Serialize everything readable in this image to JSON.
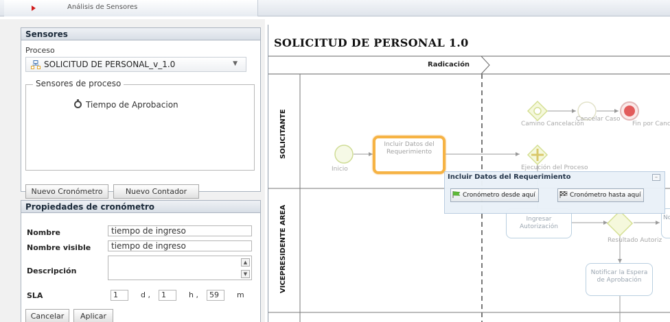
{
  "window": {
    "tab_title": "Análisis de Sensores"
  },
  "sensores_panel": {
    "header": "Sensores",
    "process_label": "Proceso",
    "process_selected": "SOLICITUD DE PERSONAL_v_1.0",
    "fieldset_legend": "Sensores de proceso",
    "sensors": [
      "Tiempo de Aprobacion"
    ],
    "btn_new_chrono": "Nuevo Cronómetro",
    "btn_new_counter": "Nuevo Contador"
  },
  "props_panel": {
    "header": "Propiedades de cronómetro",
    "name_label": "Nombre",
    "name_value": "tiempo de ingreso",
    "visible_label": "Nombre visible",
    "visible_value": "tiempo de ingreso",
    "desc_label": "Descripción",
    "desc_value": "",
    "sla_label": "SLA",
    "sla_days": "1",
    "sla_days_unit": "d ,",
    "sla_hours": "1",
    "sla_hours_unit": "h ,",
    "sla_minutes": "59",
    "sla_minutes_unit": "m",
    "btn_cancel": "Cancelar",
    "btn_apply": "Aplicar"
  },
  "diagram": {
    "title": "SOLICITUD DE PERSONAL 1.0",
    "phase": "Radicación",
    "lanes": [
      "SOLICITANTE",
      "VICEPRESIDENTE AREA"
    ],
    "nodes": {
      "start": "Inicio",
      "task_incluir": "Incluir Datos del Requerimiento",
      "gw_camino": "Camino Cancelación",
      "ev_cancelar": "Cancelar Caso",
      "ev_fin": "Fin por Canc",
      "gw_ejecucion": "Ejecución del Proceso",
      "task_ingresar": "Ingresar Autorización",
      "gw_resultado": "Resultado Autoriz",
      "task_notificar": "Notificar la Espera de Aprobación",
      "task_partial": "No"
    },
    "popup": {
      "title": "Incluir Datos del Requerimiento",
      "btn_from": "Cronómetro desde aquí",
      "btn_to": "Cronómetro hasta aquí"
    }
  },
  "colors": {
    "selected_task": "#f6b344",
    "end_event": "#e25b5b",
    "gateway": "#dfe99a",
    "tab_arrow": "#d11c1c"
  }
}
